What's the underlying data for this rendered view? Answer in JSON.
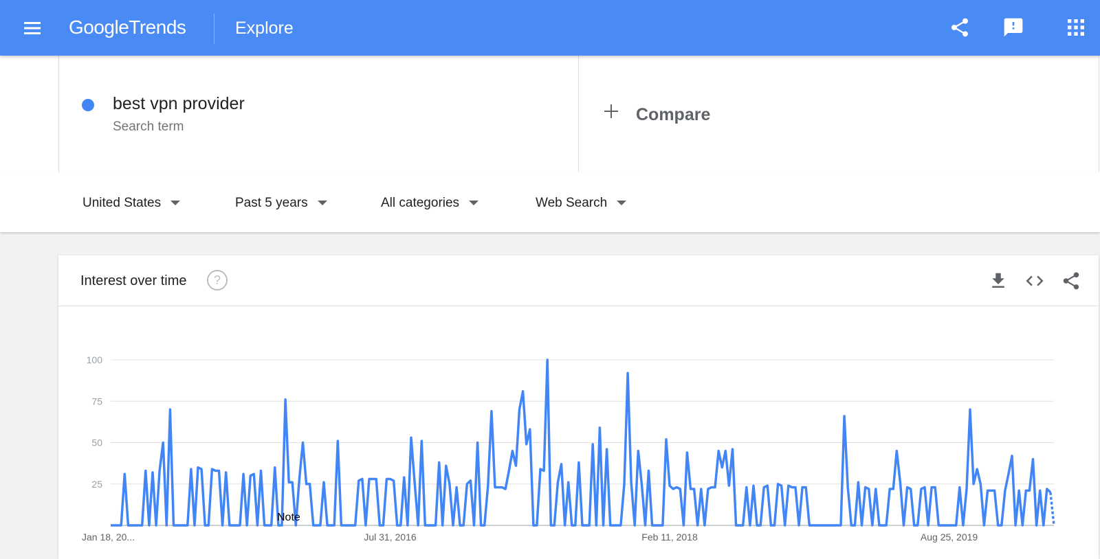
{
  "header": {
    "brand_google": "Google",
    "brand_trends": "Trends",
    "page_title": "Explore",
    "icons": [
      "menu-icon",
      "share-icon",
      "feedback-icon",
      "apps-icon"
    ],
    "bar_color": "#4a8af4"
  },
  "search": {
    "term": "best vpn provider",
    "term_type": "Search term",
    "term_color": "#4285f4",
    "compare_label": "Compare"
  },
  "filters": {
    "region": "United States",
    "time_range": "Past 5 years",
    "category": "All categories",
    "property": "Web Search"
  },
  "card": {
    "title": "Interest over time",
    "help": "?",
    "icons": [
      "download-icon",
      "embed-icon",
      "share-icon"
    ]
  },
  "chart_data": {
    "type": "line",
    "x_tick_labels": [
      "Jan 18, 20...",
      "Jul 31, 2016",
      "Feb 11, 2018",
      "Aug 25, 2019"
    ],
    "ylim": [
      0,
      100
    ],
    "y_ticks": [
      25,
      50,
      75,
      100
    ],
    "grid": true,
    "annotation": "Note",
    "series": [
      {
        "color": "#4285f4",
        "last_point_partial": true,
        "values": [
          0,
          0,
          0,
          0,
          31,
          0,
          0,
          0,
          0,
          0,
          33,
          0,
          32,
          0,
          33,
          50,
          0,
          70,
          0,
          0,
          0,
          0,
          0,
          34,
          0,
          35,
          34,
          0,
          0,
          34,
          33,
          33,
          0,
          32,
          0,
          0,
          0,
          0,
          31,
          0,
          30,
          31,
          0,
          33,
          0,
          0,
          0,
          35,
          0,
          0,
          76,
          26,
          26,
          0,
          28,
          50,
          25,
          25,
          0,
          0,
          0,
          26,
          0,
          0,
          0,
          51,
          0,
          0,
          0,
          0,
          0,
          27,
          28,
          0,
          28,
          28,
          28,
          0,
          0,
          28,
          28,
          27,
          0,
          0,
          29,
          0,
          53,
          26,
          0,
          51,
          0,
          0,
          0,
          0,
          38,
          0,
          36,
          25,
          0,
          23,
          0,
          0,
          25,
          27,
          0,
          50,
          0,
          0,
          24,
          69,
          23,
          23,
          23,
          22,
          33,
          45,
          36,
          70,
          81,
          49,
          58,
          0,
          0,
          34,
          33,
          100,
          0,
          0,
          26,
          37,
          0,
          26,
          0,
          0,
          38,
          0,
          0,
          0,
          49,
          0,
          59,
          0,
          46,
          0,
          0,
          0,
          0,
          25,
          92,
          26,
          0,
          45,
          25,
          0,
          33,
          0,
          0,
          0,
          0,
          52,
          24,
          22,
          23,
          22,
          0,
          44,
          22,
          22,
          0,
          22,
          0,
          22,
          23,
          23,
          45,
          35,
          45,
          24,
          46,
          0,
          0,
          0,
          23,
          0,
          24,
          0,
          0,
          23,
          24,
          0,
          0,
          25,
          24,
          0,
          24,
          23,
          23,
          0,
          23,
          23,
          0,
          0,
          0,
          0,
          0,
          0,
          0,
          0,
          0,
          0,
          66,
          23,
          0,
          0,
          26,
          0,
          23,
          22,
          0,
          22,
          0,
          0,
          0,
          22,
          22,
          45,
          26,
          0,
          23,
          22,
          0,
          0,
          22,
          23,
          0,
          23,
          23,
          0,
          0,
          0,
          0,
          0,
          0,
          23,
          0,
          22,
          70,
          25,
          34,
          25,
          0,
          21,
          21,
          21,
          0,
          0,
          21,
          31,
          42,
          0,
          21,
          0,
          21,
          21,
          40,
          0,
          21,
          0,
          22,
          20,
          0
        ]
      }
    ]
  }
}
